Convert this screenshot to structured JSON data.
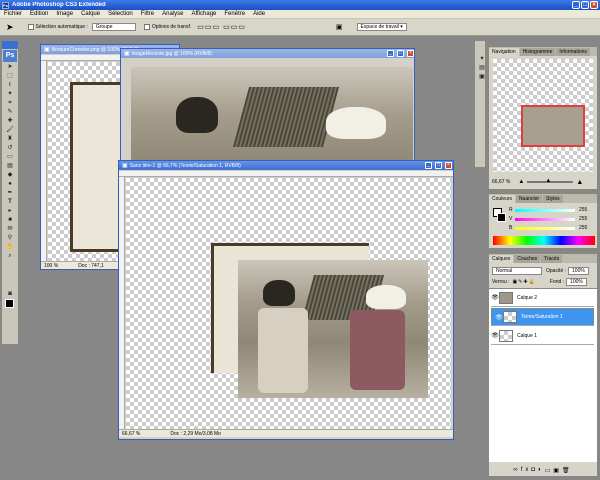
{
  "app": {
    "title": "Adobe Photoshop CS3 Extended"
  },
  "menu": [
    "Fichier",
    "Edition",
    "Image",
    "Calque",
    "Sélection",
    "Filtre",
    "Analyse",
    "Affichage",
    "Fenêtre",
    "Aide"
  ],
  "options": {
    "auto_select_label": "Sélection automatique :",
    "auto_select_value": "Groupe",
    "transform_label": "Options de transf.",
    "workspace_label": "Espace de travail"
  },
  "toolbox": {
    "logo": "Ps"
  },
  "docs": [
    {
      "title": "BordureCrenelee.png @ 100% (RVB/8)",
      "zoom": "100 %",
      "info": "Doc : 747,1"
    },
    {
      "title": "ImageRecente.jpg @ 100% (RVB/8)"
    },
    {
      "title": "Sans titre-1 @ 66,7% (Teinte/Saturation 1, RVB/8)",
      "zoom": "66,67 %",
      "info": "Doc : 2,29 Mo/3,08 Mo"
    }
  ],
  "navigator": {
    "tabs": [
      "Navigation",
      "Histogramme",
      "Informations"
    ],
    "zoom": "66,67 %"
  },
  "color": {
    "tabs": [
      "Couleurs",
      "Nuancier",
      "Styles"
    ],
    "channels": [
      {
        "label": "R",
        "value": "255"
      },
      {
        "label": "V",
        "value": "255"
      },
      {
        "label": "B",
        "value": "255"
      }
    ]
  },
  "layers": {
    "tabs": [
      "Calques",
      "Couches",
      "Tracés"
    ],
    "mode": "Normal",
    "opacity_label": "Opacité :",
    "opacity": "100%",
    "lock_label": "Verrou :",
    "fill_label": "Fond :",
    "fill": "100%",
    "items": [
      {
        "name": "Calque 2",
        "selected": false
      },
      {
        "name": "Teinte/Saturation 1",
        "selected": true
      },
      {
        "name": "Calque 1",
        "selected": false
      }
    ]
  }
}
